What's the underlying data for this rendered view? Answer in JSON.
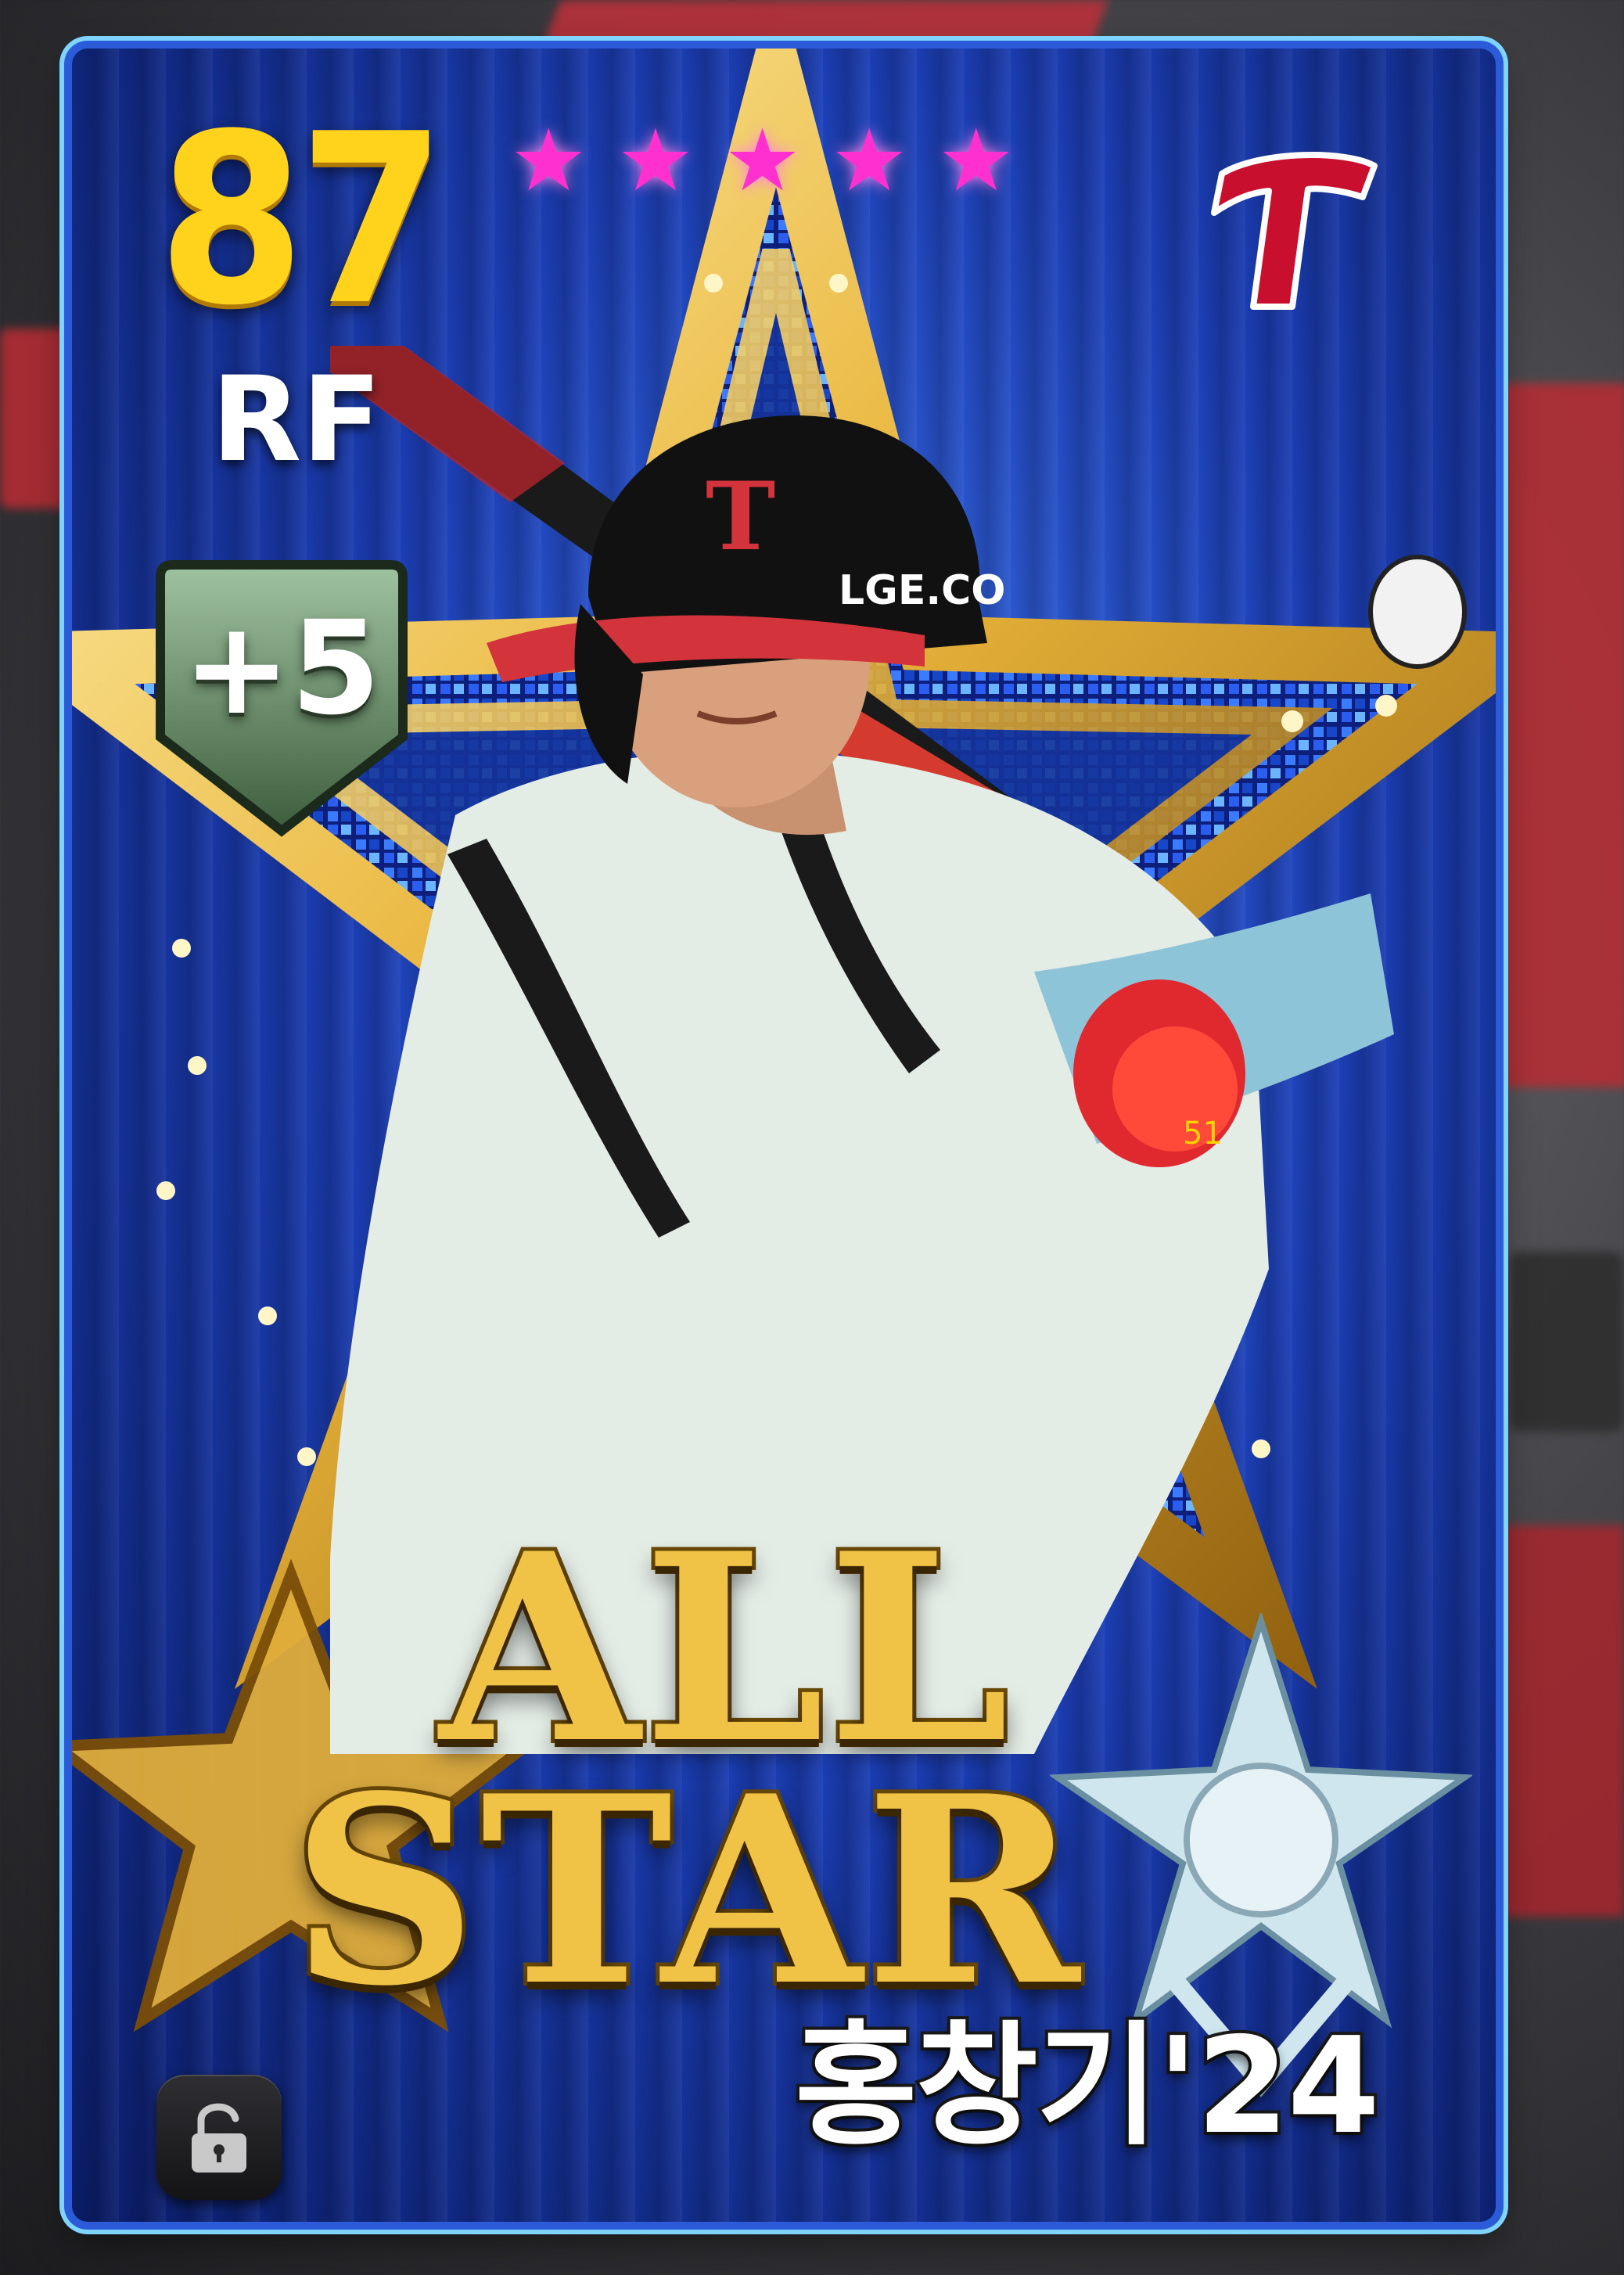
{
  "card": {
    "rating": "87",
    "position": "RF",
    "star_count": 5,
    "upgrade_level": "+5",
    "team_logo_letter": "T",
    "title_line1": "ALL",
    "title_line2": "STAR",
    "player_name": "홍창기'24",
    "helmet_sponsor": "LGE.CO",
    "sleeve_number": "51",
    "lock_state": "unlocked"
  },
  "colors": {
    "rating": "#ffd21c",
    "stars": "#ff2fd0",
    "team_red": "#c8102e",
    "card_blue": "#1c3fb7",
    "gold": "#f0c347"
  },
  "icons": {
    "star": "star-icon",
    "lock": "unlocked-padlock-icon",
    "team": "team-t-logo-icon",
    "emblem": "allstar-emblem-icon"
  }
}
